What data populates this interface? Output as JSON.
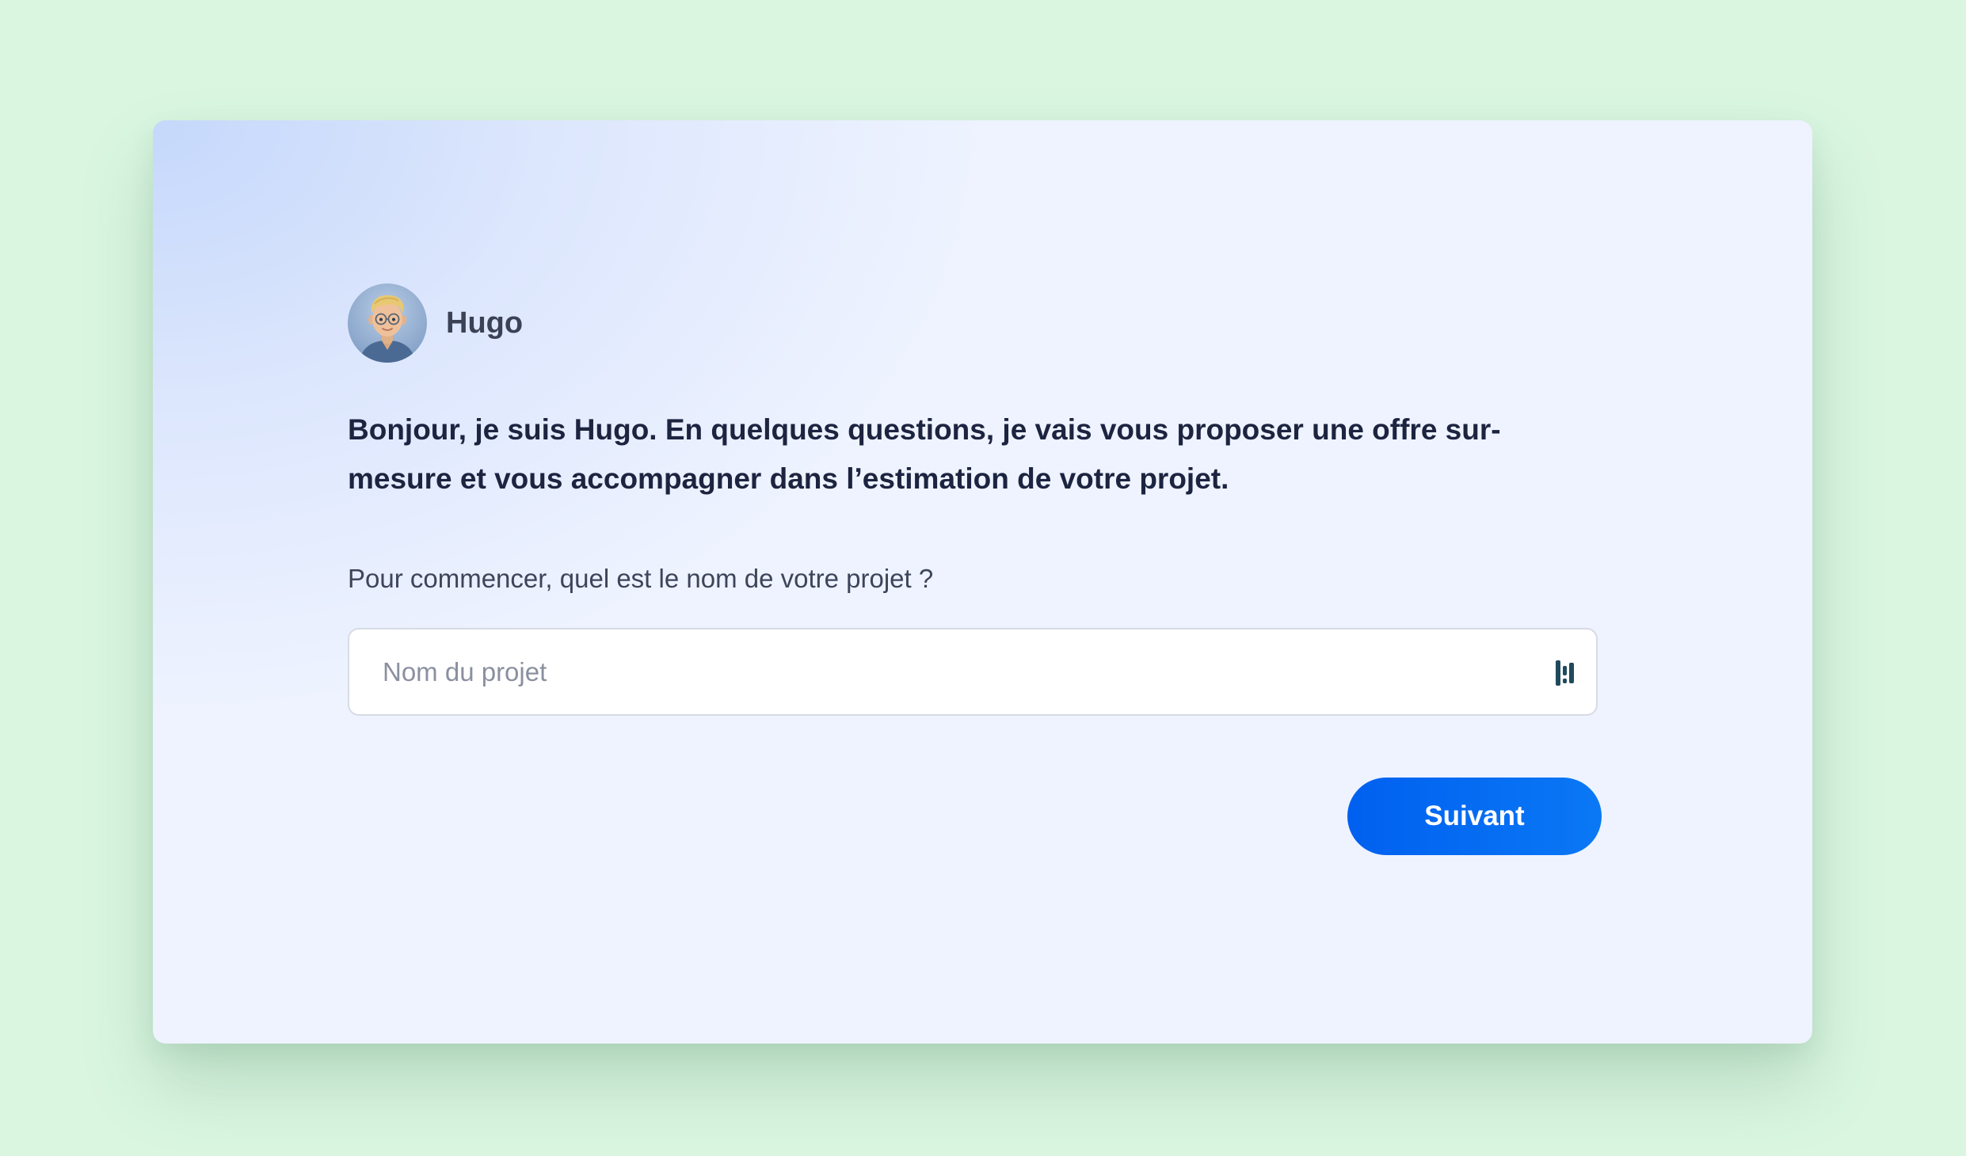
{
  "agent": {
    "name": "Hugo",
    "avatar_icon": "memoji-avatar-icon"
  },
  "intro": {
    "text": "Bonjour, je suis Hugo. En quelques questions, je vais vous proposer une offre sur-mesure et vous accompagner dans l’estimation de votre projet."
  },
  "form": {
    "question": "Pour commencer, quel est le nom de votre projet ?",
    "project_name_value": "",
    "project_name_placeholder": "Nom du projet",
    "field_icon": "password-manager-icon",
    "next_label": "Suivant"
  },
  "colors": {
    "page_background": "#daf6e1",
    "card_background": "#eef3ff",
    "accent": "#0066f2",
    "text_primary": "#1c2440"
  }
}
